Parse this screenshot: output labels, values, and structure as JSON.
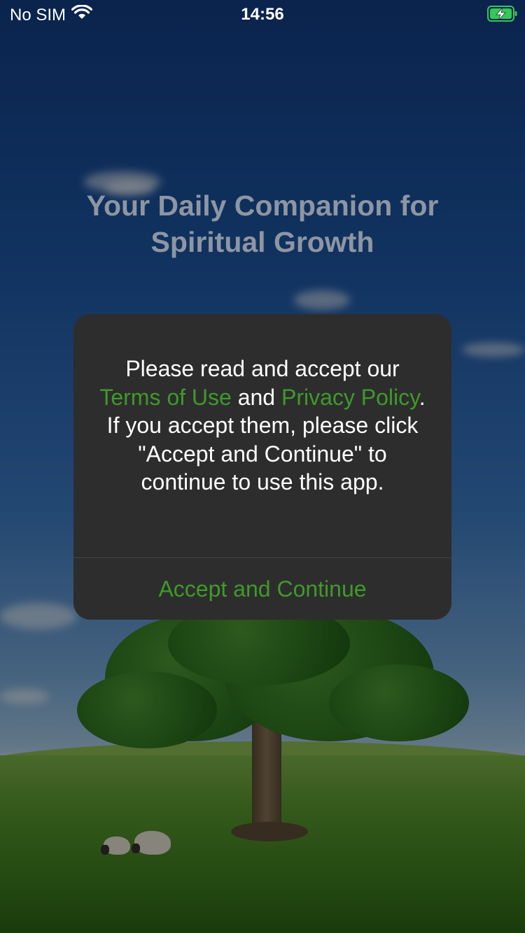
{
  "status_bar": {
    "carrier": "No SIM",
    "time": "14:56",
    "wifi_icon": "wifi-icon",
    "battery_icon": "battery-charging-icon",
    "battery_color": "#34c759"
  },
  "background": {
    "title_line1": "Your Daily Companion for",
    "title_line2": "Spiritual Growth"
  },
  "alert": {
    "message_part1": "Please read and accept our ",
    "terms_link": "Terms of Use",
    "message_part2": " and ",
    "privacy_link": "Privacy Policy",
    "message_part3": ". If you accept them, please click \"Accept and Continue\" to continue to use this app.",
    "accept_button": "Accept and Continue",
    "link_color": "#3f9a2a"
  }
}
